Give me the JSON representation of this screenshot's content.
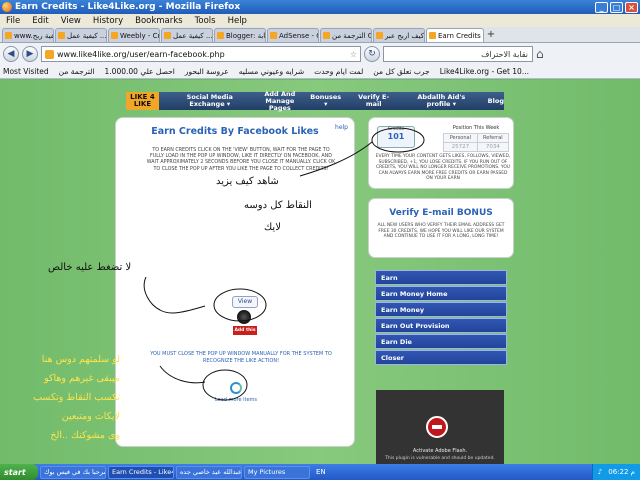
{
  "window": {
    "title": "Earn Credits - Like4Like.org - Mozilla Firefox"
  },
  "menu": [
    "File",
    "Edit",
    "View",
    "History",
    "Bookmarks",
    "Tools",
    "Help"
  ],
  "tabs": [
    {
      "label": "www.كيفية ربح ..."
    },
    {
      "label": "كيفية عمل ..."
    },
    {
      "label": "Weebly - Creat..."
    },
    {
      "label": "كيفية عمل ..."
    },
    {
      "label": "Blogger: نقابة ..."
    },
    {
      "label": "AdSense - Goo..."
    },
    {
      "label": "الترجمة من G..."
    },
    {
      "label": "كيف اربح عبر ..."
    },
    {
      "label": "Earn Credits ..."
    }
  ],
  "nav": {
    "url": "www.like4like.org/user/earn-facebook.php",
    "search": "نقابة الاحتراف"
  },
  "bookmarks": [
    "Most Visited",
    "الترجمة من",
    "1.000.00 احصل علي",
    "عروسة البحور",
    "شرايه وعيوني مسليه",
    "لمت ايام وحدت",
    "جرب تعلق كل من",
    "Like4Like.org - Get 10..."
  ],
  "site_nav": {
    "logo": "LIKE 4 LIKE",
    "items": [
      "Social Media Exchange ▾",
      "Add And Manage Pages",
      "Bonuses ▾",
      "Verify E-mail",
      "Abdallh Aid's profile ▾",
      "Blog"
    ]
  },
  "main": {
    "title": "Earn Credits By Facebook Likes",
    "help": "help",
    "instructions": "TO EARN CREDITS CLICK ON THE 'VIEW' BUTTON, WAIT FOR THE PAGE TO FULLY LOAD IN THE POP UP WINDOW, LIKE IT DIRECTLY ON FACEBOOK, AND WAIT APPROXIMATELY 2 SECONDS BEFORE YOU CLOSE IT MANUALLY. CLICK OK TO CLOSE THE POP UP AFTER YOU LIKE THE PAGE TO COLLECT CREDITS!",
    "handwriting": [
      "شاهد كيف يزيد",
      "النقاط كل دوسه",
      "لايك"
    ],
    "handwriting_small": "لا تضغط عليه خالص",
    "view_button": "View",
    "add_button": "Add this",
    "must_close": "YOU MUST CLOSE THE POP UP WINDOW MANUALLY FOR THE SYSTEM TO RECOGNIZE THE LIKE ACTION!",
    "load_more": "Load more items"
  },
  "stats": {
    "credits_label": "Credits",
    "credits": "101",
    "points_header": "Position This Week",
    "personal_label": "Personal",
    "referral_label": "Referral",
    "personal": "25727",
    "referral": "7034",
    "note": "EVERY TIME YOUR CONTENT GETS LIKES, FOLLOWS, VIEWED, SUBSCRIBED, +1, YOU LOSE CREDITS. IF YOU RUN OUT OF CREDITS, YOU WILL NO LONGER RECEIVE PROMOTIONS. YOU CAN ALWAYS EARN MORE FREE CREDITS OR EARN PASSED ON YOUR EARN"
  },
  "verify": {
    "title": "Verify E-mail BONUS",
    "note": "ALL NEW USERS WHO VERIFY THEIR EMAIL ADDRESS GET FREE 30 CREDITS, WE HOPE YOU WILL LIKE OUR SYSTEM AND CONTINUE TO USE IT FOR A LONG, LONG TIME!"
  },
  "side_menu": [
    "Earn",
    "Earn Money Home",
    "Earn Money",
    "Earn Out Provision",
    "Earn Die",
    "Closer"
  ],
  "flash": {
    "line1": "Activate Adobe Flash.",
    "line2": "This plugin is vulnerable and should be updated."
  },
  "left_overlay": [
    "لو سلمتهم دوس هنا",
    "ميبقى غيرهم وهاكو",
    "تكسب النقاط وتكسب",
    "لايكات ومتبعين",
    "وى مشوكنك ..الخ"
  ],
  "taskbar": {
    "start": "start",
    "items": [
      "مرحبا بك في فيس بوك",
      "Earn Credits - Like4L...",
      "عبدالله عيد خاصي جده...",
      "My Pictures"
    ],
    "lang": "EN",
    "time": "06:22 م"
  }
}
